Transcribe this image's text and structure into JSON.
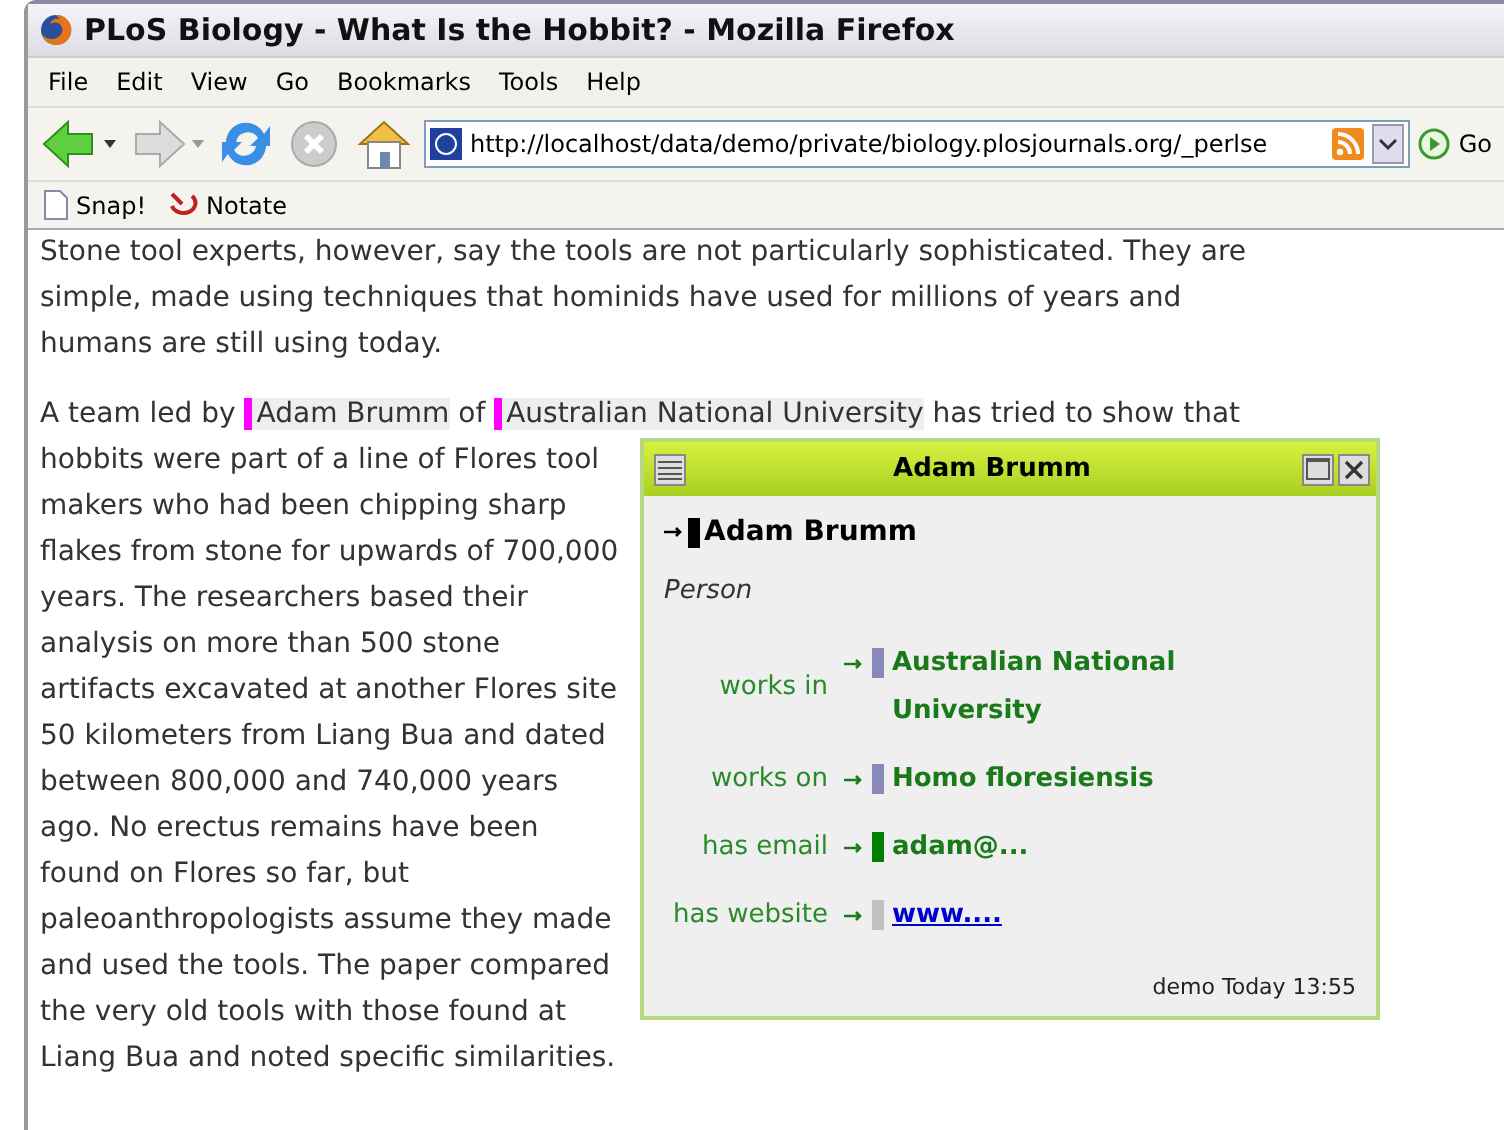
{
  "window": {
    "title": "PLoS Biology - What Is the Hobbit? - Mozilla Firefox"
  },
  "menu": [
    "File",
    "Edit",
    "View",
    "Go",
    "Bookmarks",
    "Tools",
    "Help"
  ],
  "address_bar": {
    "value": "http://localhost/data/demo/private/biology.plosjournals.org/_perlse"
  },
  "go_button": "Go",
  "bookmarks": [
    "Snap!",
    "Notate"
  ],
  "paragraphs": [
    {
      "parts": [
        {
          "text": "Stone tool experts, however, say the tools are not particularly sophisticated. They are simple, made using techniques that hominids have used for millions of years and humans are still using today."
        }
      ]
    },
    {
      "parts": [
        {
          "text": "A team led by "
        },
        {
          "annotation": "Adam Brumm"
        },
        {
          "text": " of "
        },
        {
          "annotation": "Australian National University"
        },
        {
          "text": " has tried to show that hobbits were part of a line of Flores tool makers who had been chipping sharp flakes from stone for upwards of 700,000 years. The researchers based their analysis on more than 500 stone artifacts excavated at another Flores site 50 kilometers from Liang Bua and dated between 800,000 and 740,000 years ago. No erectus remains have been found on Flores so far, but paleoanthropologists assume they made and used the tools. The paper compared the very old tools with those found at Liang Bua and noted specific similarities."
        }
      ],
      "popup": {
        "title": "Adam Brumm",
        "heading": "Adam Brumm",
        "type": "Person",
        "properties": [
          {
            "label": "works in",
            "value": "Australian National University",
            "kind": "text",
            "color": "#8888bb"
          },
          {
            "label": "works on",
            "value": "Homo floresiensis",
            "kind": "text",
            "color": "#8888bb"
          },
          {
            "label": "has email",
            "value": "adam@...",
            "kind": "text",
            "color": "#008000"
          },
          {
            "label": "has website",
            "value": "www....",
            "kind": "link",
            "color": "#c0c0c0"
          }
        ],
        "footer": "demo Today 13:55"
      }
    }
  ]
}
